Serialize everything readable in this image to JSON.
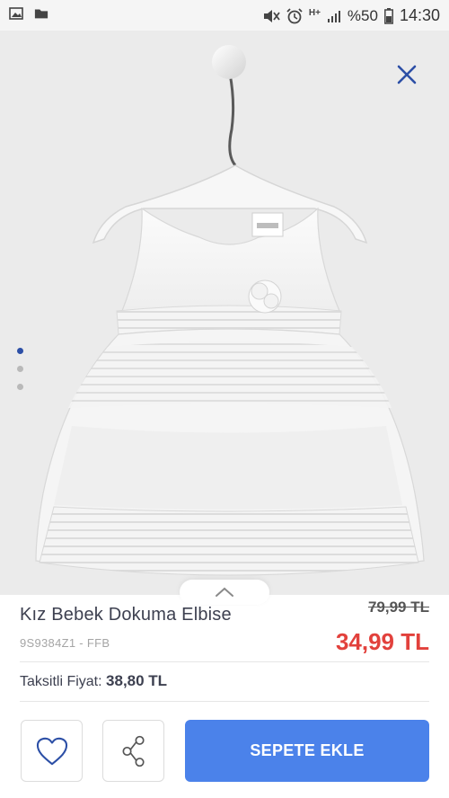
{
  "status_bar": {
    "battery_percent": "%50",
    "time": "14:30",
    "network": "H+"
  },
  "product": {
    "title": "Kız Bebek Dokuma Elbise",
    "sku": "9S9384Z1 - FFB",
    "old_price": "79,99 TL",
    "price": "34,99 TL",
    "installment_label": "Taksitli Fiyat:",
    "installment_price": "38,80 TL",
    "image_label": "LCW"
  },
  "gallery": {
    "image_count": 3,
    "active_index": 0
  },
  "actions": {
    "add_to_cart_label": "SEPETE EKLE"
  },
  "colors": {
    "accent_blue": "#4b82ea",
    "price_red": "#e2413c",
    "dark_blue": "#2c4fa6"
  },
  "icons": [
    "image-icon",
    "folder-icon",
    "mute-icon",
    "alarm-icon",
    "signal-icon",
    "battery-icon",
    "close-icon",
    "chevron-up-icon",
    "heart-icon",
    "share-icon"
  ]
}
